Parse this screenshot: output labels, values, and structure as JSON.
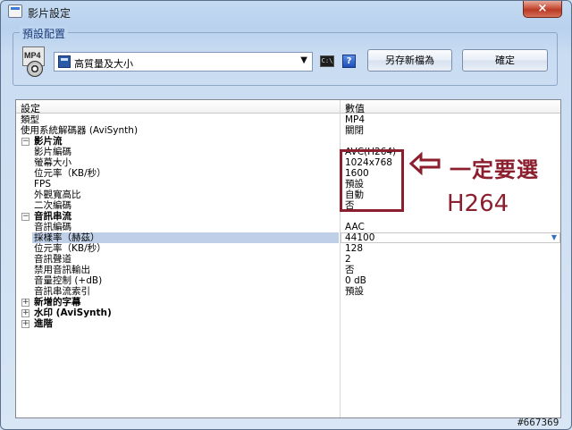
{
  "window": {
    "title": "影片設定",
    "close_label": "×"
  },
  "preset_group": {
    "legend": "預設配置",
    "icon_label": "MP4",
    "selected_preset": "高質量及大小",
    "cmd_label": "C:\\",
    "help_label": "?",
    "save_as_label": "另存新檔為",
    "ok_label": "確定"
  },
  "grid": {
    "header_setting": "設定",
    "header_value": "數值",
    "rows": [
      {
        "name": "類型",
        "value": "MP4"
      },
      {
        "name": "使用系統解碼器 (AviSynth)",
        "value": "關閉"
      },
      {
        "name": "影片流",
        "expander": "−"
      },
      {
        "name": "影片編碼",
        "value": "AVC(H264)"
      },
      {
        "name": "螢幕大小",
        "value": "1024x768"
      },
      {
        "name": "位元率（KB/秒）",
        "value": "1600"
      },
      {
        "name": "FPS",
        "value": "預設"
      },
      {
        "name": "外觀寬高比",
        "value": "自動"
      },
      {
        "name": "二次編碼",
        "value": "否"
      },
      {
        "name": "音訊串流",
        "expander": "−"
      },
      {
        "name": "音訊編碼",
        "value": "AAC"
      },
      {
        "name": "採樣率（赫茲）",
        "value": "44100"
      },
      {
        "name": "位元率（KB/秒）",
        "value": "128"
      },
      {
        "name": "音訊聲道",
        "value": "2"
      },
      {
        "name": "禁用音訊輸出",
        "value": "否"
      },
      {
        "name": "音量控制 (+dB)",
        "value": "0 dB"
      },
      {
        "name": "音訊串流索引",
        "value": "預設"
      },
      {
        "name": "新增的字幕",
        "expander": "+"
      },
      {
        "name": "水印 (AviSynth)",
        "expander": "+"
      },
      {
        "name": "進階",
        "expander": "+"
      }
    ]
  },
  "annotation": {
    "line1": "一定要選",
    "line2": "H264",
    "color": "#8c1f2e"
  },
  "watermark": "#667369"
}
